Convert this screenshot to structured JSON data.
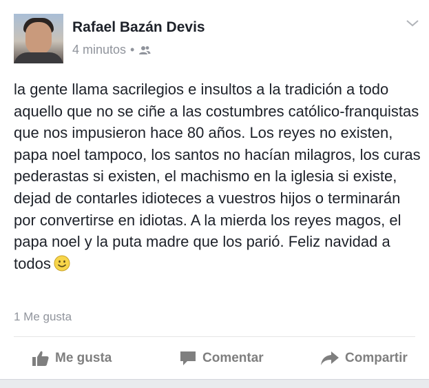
{
  "post": {
    "author": "Rafael Bazán Devis",
    "time": "4 minutos",
    "separator": "•",
    "text": "la gente llama sacrilegios e insultos a la tradición a todo aquello que no se ciñe a las costumbres católico-franquistas que nos impusieron hace 80 años. Los reyes no existen, papa noel tampoco, los santos no hacían milagros, los curas pederastas si existen, el machismo en la iglesia si existe, dejad de contarles idioteces a vuestros hijos o terminarán por convertirse en idiotas. A la mierda los reyes magos, el papa noel y la puta madre que los parió. Feliz navidad a todos",
    "likes_summary": "1 Me gusta"
  },
  "actions": {
    "like": "Me gusta",
    "comment": "Comentar",
    "share": "Compartir"
  },
  "icons": {
    "audience": "friends-icon",
    "menu": "chevron-down-icon",
    "emoji": "smiley-emoji-icon",
    "like": "thumbs-up-icon",
    "comment": "speech-bubble-icon",
    "share": "share-arrow-icon"
  },
  "colors": {
    "text": "#1d2129",
    "meta": "#90949c",
    "action": "#7f7f7f",
    "background": "#e9ebee"
  }
}
